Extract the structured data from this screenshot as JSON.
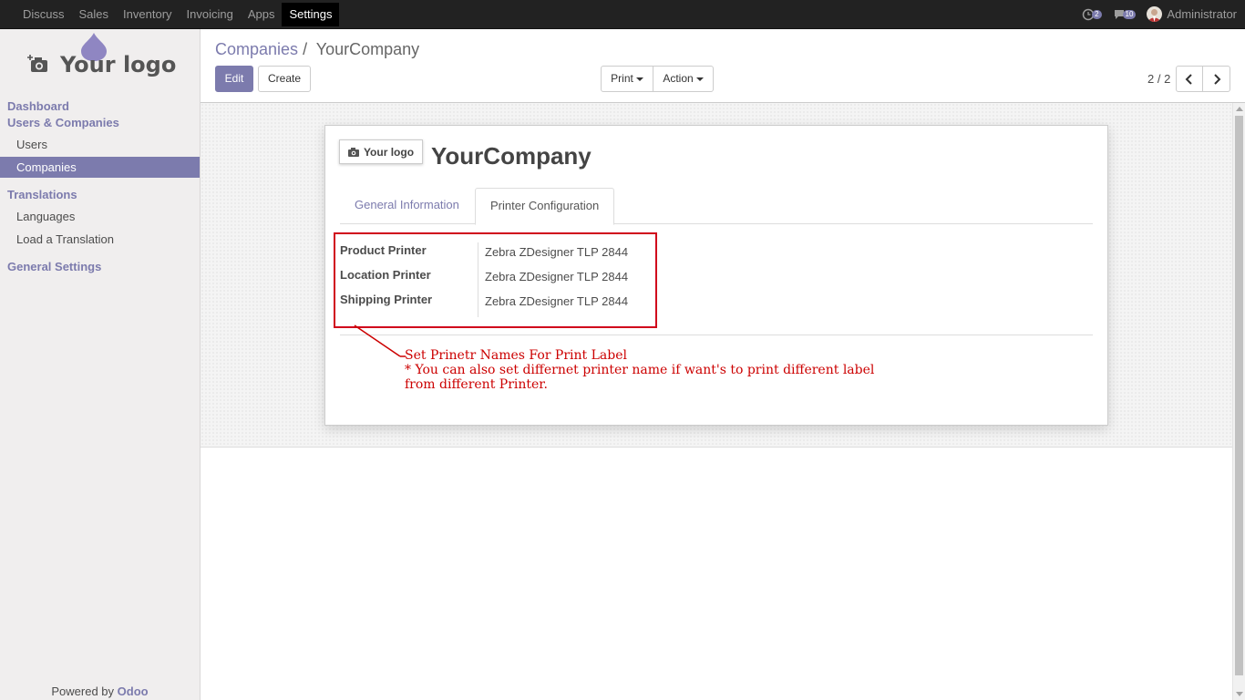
{
  "topbar": {
    "menus": [
      "Discuss",
      "Sales",
      "Inventory",
      "Invoicing",
      "Apps",
      "Settings"
    ],
    "active_menu": "Settings",
    "activity_count": "2",
    "message_count": "10",
    "user_name": "Administrator"
  },
  "sidebar": {
    "logo_text": "Your logo",
    "sections": {
      "dashboard": "Dashboard",
      "users_companies": "Users & Companies",
      "translations": "Translations",
      "general_settings": "General Settings"
    },
    "items": {
      "users": "Users",
      "companies": "Companies",
      "languages": "Languages",
      "load_translation": "Load a Translation"
    },
    "powered_by": "Powered by",
    "powered_brand": "Odoo"
  },
  "control": {
    "breadcrumb_parent": "Companies",
    "breadcrumb_separator": "/",
    "breadcrumb_current": "YourCompany",
    "edit_label": "Edit",
    "create_label": "Create",
    "print_label": "Print",
    "action_label": "Action",
    "pager": "2 / 2"
  },
  "form": {
    "logo_text": "Your logo",
    "company_name": "YourCompany",
    "tabs": [
      "General Information",
      "Printer Configuration"
    ],
    "active_tab": "Printer Configuration",
    "fields": [
      {
        "label": "Product Printer",
        "value": "Zebra ZDesigner TLP 2844"
      },
      {
        "label": "Location Printer",
        "value": "Zebra ZDesigner TLP 2844"
      },
      {
        "label": "Shipping Printer",
        "value": "Zebra ZDesigner TLP 2844"
      }
    ]
  },
  "annotation": {
    "line1": "Set Prinetr Names For Print Label",
    "line2": "* You can also set differnet printer name if want's to print different label",
    "line3": "from different Printer.",
    "color": "#cc0000"
  },
  "colors": {
    "accent": "#7c7bad",
    "topbar": "#222222",
    "annotation_red": "#d0021b"
  }
}
